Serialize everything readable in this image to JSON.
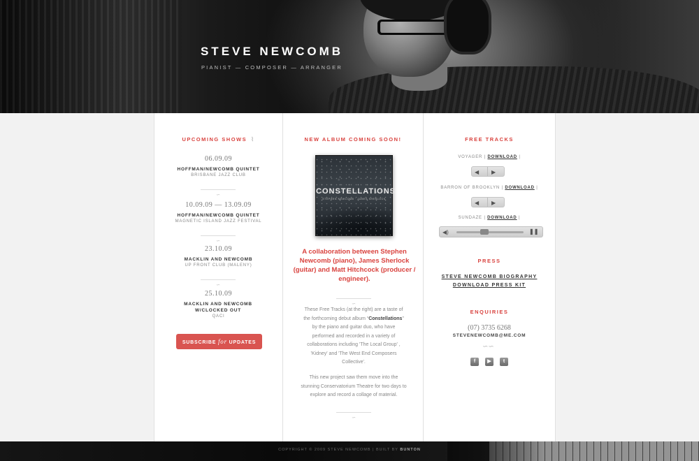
{
  "header": {
    "name": "STEVE NEWCOMB",
    "tagline": "PIANIST — COMPOSER — ARRANGER"
  },
  "shows": {
    "title": "UPCOMING SHOWS",
    "rss_icon": "rss-icon",
    "items": [
      {
        "date": "06.09.09",
        "act": "HOFFMAN/NEWCOMB QUINTET",
        "venue": "BRISBANE JAZZ CLUB"
      },
      {
        "date": "10.09.09 — 13.09.09",
        "act": "HOFFMAN/NEWCOMB QUINTET",
        "venue": "MAGNETIC ISLAND JAZZ FESTIVAL"
      },
      {
        "date": "23.10.09",
        "act": "MACKLIN AND NEWCOMB",
        "venue": "UP FRONT CLUB (MALENY)"
      },
      {
        "date": "25.10.09",
        "act": "MACKLIN AND NEWCOMB W/CLOCKED OUT",
        "venue": "QACI"
      }
    ],
    "subscribe_pre": "SUBSCRIBE ",
    "subscribe_for": "for",
    "subscribe_post": " UPDATES"
  },
  "album": {
    "title": "NEW ALBUM COMING SOON!",
    "cover_title": "CONSTELLATIONS",
    "cover_sub": "STEPHEN NEWCOMB · JAMES SHERLOCK",
    "collab": "A collaboration between Stephen Newcomb (piano), James Sherlock (guitar) and Matt Hitchcock (producer / engineer).",
    "desc1_pre": "These Free Tracks (at the right) are a taste of the forthcoming debut album “",
    "desc1_bold": "Constellations",
    "desc1_post": "” by the piano and guitar duo, who have performed and recorded in a variety of collaborations including 'The Local Group' , 'Kidney' and 'The West End Composers Collective'.",
    "desc2": "This new project saw them move into the stunning Conservatorium Theatre for two days to explore and record a collage of material."
  },
  "tracks": {
    "title": "FREE TRACKS",
    "download_label": "DOWNLOAD",
    "items": [
      {
        "name": "VOYAGER"
      },
      {
        "name": "BARRON OF BROOKLYN"
      },
      {
        "name": "SUNDAZE"
      }
    ],
    "player_progress": 0.4
  },
  "press": {
    "title": "PRESS",
    "biography": "STEVE NEWCOMB BIOGRAPHY",
    "kit": "DOWNLOAD PRESS KIT"
  },
  "enquiries": {
    "title": "ENQUIRIES",
    "phone": "(07) 3735 6268",
    "email": "STEVENEWCOMB@ME.COM",
    "social": [
      {
        "icon": "facebook-icon",
        "glyph": "f"
      },
      {
        "icon": "youtube-icon",
        "glyph": "▶"
      },
      {
        "icon": "twitter-icon",
        "glyph": "t"
      }
    ]
  },
  "footer": {
    "copyright": "COPYRIGHT © 2009 STEVE NEWCOMB | BUILT BY ",
    "builder": "BUNTON"
  }
}
